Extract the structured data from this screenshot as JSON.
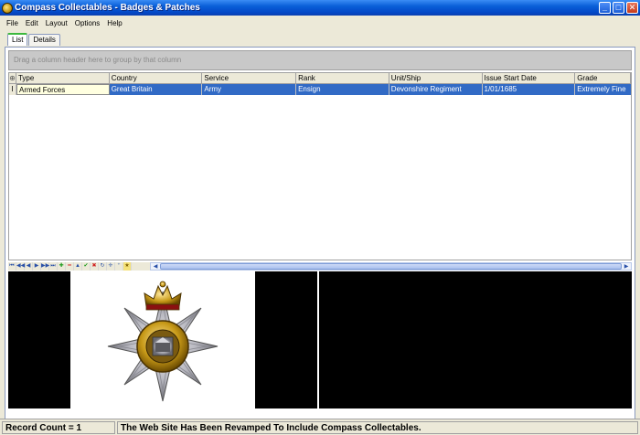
{
  "window": {
    "title": "Compass Collectables - Badges & Patches",
    "minimize": "_",
    "maximize": "□",
    "close": "✕"
  },
  "menu": [
    "File",
    "Edit",
    "Layout",
    "Options",
    "Help"
  ],
  "tabs": [
    {
      "label": "List",
      "active": true
    },
    {
      "label": "Details",
      "active": false
    }
  ],
  "group_panel_text": "Drag a column header here to group by that column",
  "grid": {
    "columns": [
      "Type",
      "Country",
      "Service",
      "Rank",
      "Unit/Ship",
      "Issue Start Date",
      "Grade"
    ],
    "rows": [
      {
        "indicator": "I",
        "cells": [
          "Armed Forces",
          "Great Britain",
          "Army",
          "Ensign",
          "Devonshire Regiment",
          "1/01/1685",
          "Extremely Fine"
        ]
      }
    ]
  },
  "navigator_icons": [
    "first-icon",
    "prev-page-icon",
    "prev-icon",
    "next-icon",
    "next-page-icon",
    "last-icon",
    "insert-icon",
    "delete-icon",
    "edit-icon",
    "post-icon",
    "cancel-icon",
    "refresh-icon",
    "save-bookmark-icon",
    "goto-bookmark-icon",
    "filter-icon"
  ],
  "status": {
    "record_count": "Record Count = 1",
    "message": "The Web Site Has Been Revamped To Include Compass Collectables."
  },
  "colors": {
    "selection": "#316ac5",
    "titlebar": "#0a5fd8",
    "badge_gold": "#c89a18",
    "badge_silver": "#c0c0c8"
  }
}
